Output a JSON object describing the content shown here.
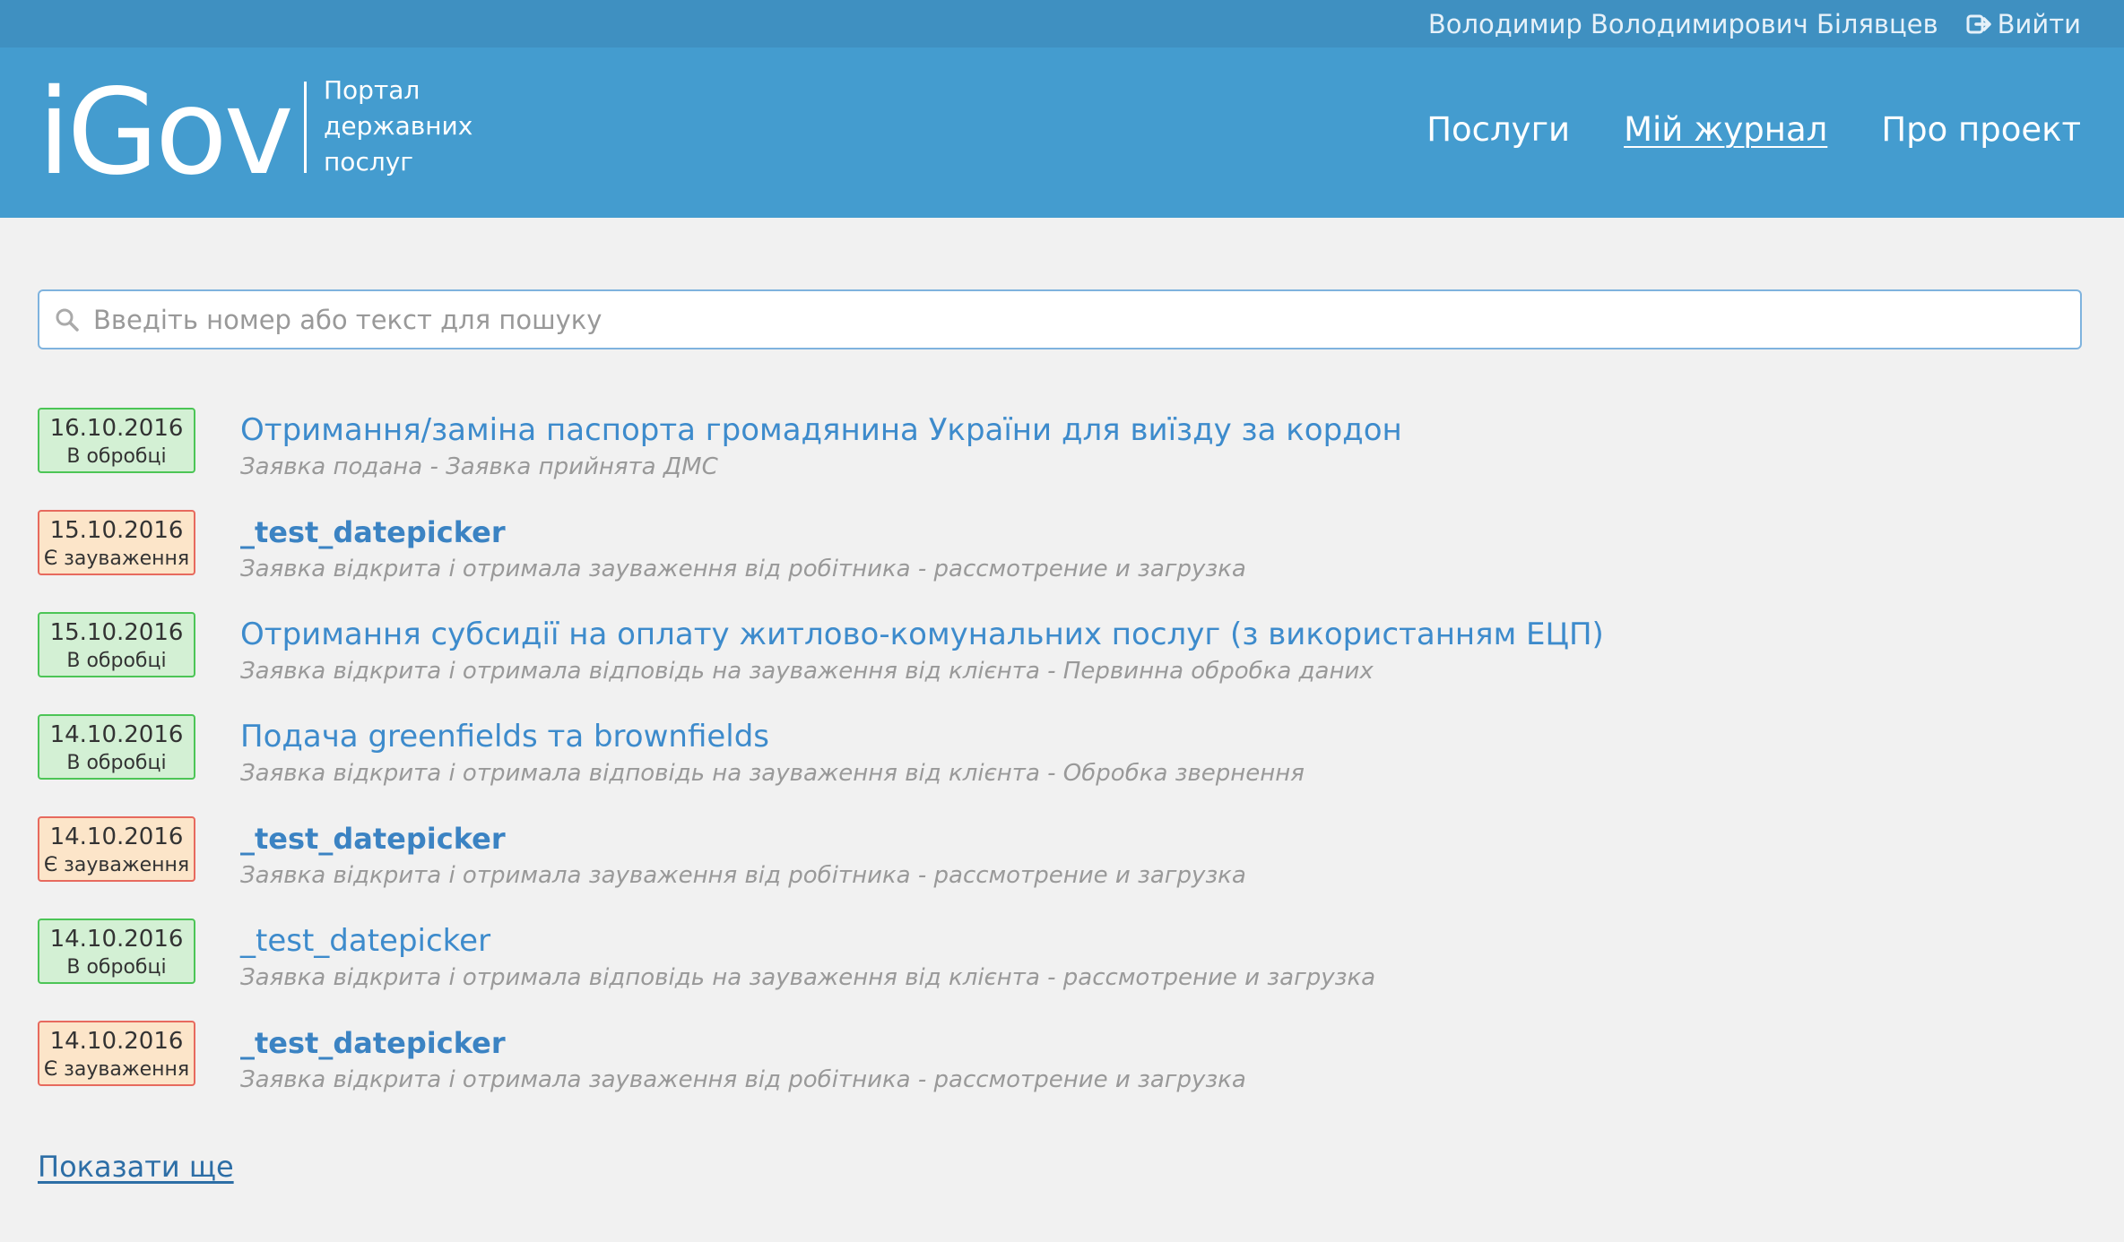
{
  "topbar": {
    "user_name": "Володимир Володимирович Білявцев",
    "logout_label": "Вийти",
    "logout_icon": "logout-icon"
  },
  "header": {
    "logo_text": "iGov",
    "tagline": [
      "Портал",
      "державних",
      "послуг"
    ],
    "nav": [
      {
        "label": "Послуги",
        "active": false
      },
      {
        "label": "Мій журнал",
        "active": true
      },
      {
        "label": "Про проект",
        "active": false
      }
    ]
  },
  "search": {
    "placeholder": "Введіть номер або текст для пошуку",
    "value": "",
    "icon": "search-icon"
  },
  "colors": {
    "topbar": "#3f90c1",
    "header": "#449ccf",
    "badge_ok_bg": "#d3f0d4",
    "badge_ok_border": "#4cc556",
    "badge_warn_bg": "#fce5c9",
    "badge_warn_border": "#e76a5e",
    "link": "#3d8bcc"
  },
  "items": [
    {
      "date": "16.10.2016",
      "status": "В обробці",
      "state": "ok",
      "title": "Отримання/заміна паспорта громадянина України для виїзду за кордон",
      "bold": false,
      "subtitle": "Заявка подана - Заявка прийнята ДМС"
    },
    {
      "date": "15.10.2016",
      "status": "Є зауваження",
      "state": "warn",
      "title": "_test_datepicker",
      "bold": true,
      "subtitle": "Заявка відкрита і отримала зауваження від робітника - рассмотрение и загрузка"
    },
    {
      "date": "15.10.2016",
      "status": "В обробці",
      "state": "ok",
      "title": "Отримання субсидії на оплату житлово-комунальних послуг (з використанням ЕЦП)",
      "bold": false,
      "subtitle": "Заявка відкрита і отримала відповідь на зауваження від клієнта - Первинна обробка даних"
    },
    {
      "date": "14.10.2016",
      "status": "В обробці",
      "state": "ok",
      "title": "Подача greenfields та brownfields",
      "bold": false,
      "subtitle": "Заявка відкрита і отримала відповідь на зауваження від клієнта - Обробка звернення"
    },
    {
      "date": "14.10.2016",
      "status": "Є зауваження",
      "state": "warn",
      "title": "_test_datepicker",
      "bold": true,
      "subtitle": "Заявка відкрита і отримала зауваження від робітника - рассмотрение и загрузка"
    },
    {
      "date": "14.10.2016",
      "status": "В обробці",
      "state": "ok",
      "title": "_test_datepicker",
      "bold": false,
      "subtitle": "Заявка відкрита і отримала відповідь на зауваження від клієнта - рассмотрение и загрузка"
    },
    {
      "date": "14.10.2016",
      "status": "Є зауваження",
      "state": "warn",
      "title": "_test_datepicker",
      "bold": true,
      "subtitle": "Заявка відкрита і отримала зауваження від робітника - рассмотрение и загрузка"
    }
  ],
  "show_more_label": "Показати ще"
}
